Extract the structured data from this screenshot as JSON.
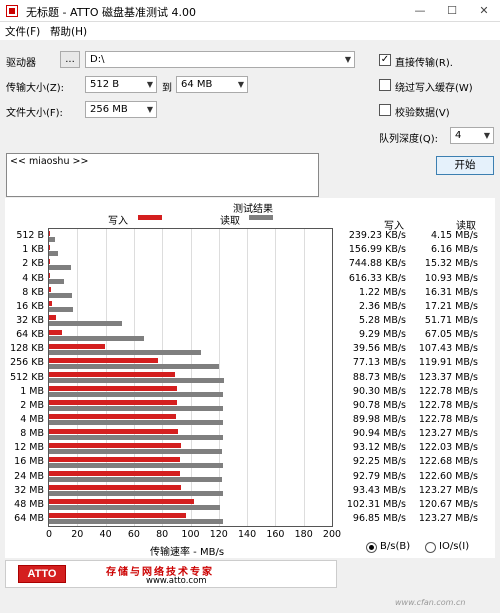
{
  "window": {
    "title": "无标题 - ATTO 磁盘基准测试 4.00",
    "minimize": "—",
    "maximize": "☐",
    "close": "✕"
  },
  "menu": {
    "file": "文件(F)",
    "help": "帮助(H)"
  },
  "controls": {
    "drive_label": "驱动器",
    "drive_browse": "...",
    "drive_value": "D:\\",
    "transfer_label": "传输大小(Z):",
    "transfer_from": "512 B",
    "to_label": "到",
    "transfer_to": "64 MB",
    "filesize_label": "文件大小(F):",
    "filesize_value": "256 MB",
    "direct_io_label": "直接传输(R).",
    "direct_io_checked": true,
    "bypass_cache_label": "绕过写入缓存(W)",
    "bypass_cache_checked": false,
    "verify_label": "校验数据(V)",
    "verify_checked": false,
    "queue_label": "队列深度(Q):",
    "queue_value": "4",
    "start_label": "开始",
    "description": "<< miaoshu >>"
  },
  "results": {
    "header": "测试结果",
    "legend_write": "写入",
    "legend_read": "读取",
    "col_write": "写入",
    "col_read": "读取",
    "xlabel": "传输速率 - MB/s",
    "unit_bs": "B/s(B)",
    "unit_ios": "IO/s(I)",
    "unit_selected": "bs"
  },
  "chart_data": {
    "type": "bar",
    "orientation": "horizontal",
    "xlim": [
      0,
      200
    ],
    "xticks": [
      0,
      20,
      40,
      60,
      80,
      100,
      120,
      140,
      160,
      180,
      200
    ],
    "categories": [
      "512 B",
      "1 KB",
      "2 KB",
      "4 KB",
      "8 KB",
      "16 KB",
      "32 KB",
      "64 KB",
      "128 KB",
      "256 KB",
      "512 KB",
      "1 MB",
      "2 MB",
      "4 MB",
      "8 MB",
      "12 MB",
      "16 MB",
      "24 MB",
      "32 MB",
      "48 MB",
      "64 MB"
    ],
    "series": [
      {
        "name": "写入",
        "color": "#d41f1f",
        "values": [
          0.23,
          0.15,
          0.73,
          0.6,
          1.19,
          2.3,
          5.16,
          9.08,
          39.56,
          77.13,
          88.73,
          90.3,
          90.78,
          89.98,
          90.94,
          93.12,
          92.25,
          92.79,
          93.43,
          102.31,
          96.85
        ]
      },
      {
        "name": "读取",
        "color": "#7f7f7f",
        "values": [
          4.15,
          6.16,
          15.32,
          10.93,
          16.31,
          17.21,
          51.71,
          67.05,
          107.43,
          119.91,
          123.37,
          122.78,
          122.78,
          122.78,
          123.27,
          122.03,
          122.68,
          122.6,
          123.27,
          120.67,
          123.27
        ]
      }
    ],
    "write_text": [
      "239.23 KB/s",
      "156.99 KB/s",
      "744.88 KB/s",
      "616.33 KB/s",
      "1.22 MB/s",
      "2.36 MB/s",
      "5.28 MB/s",
      "9.29 MB/s",
      "39.56 MB/s",
      "77.13 MB/s",
      "88.73 MB/s",
      "90.30 MB/s",
      "90.78 MB/s",
      "89.98 MB/s",
      "90.94 MB/s",
      "93.12 MB/s",
      "92.25 MB/s",
      "92.79 MB/s",
      "93.43 MB/s",
      "102.31 MB/s",
      "96.85 MB/s"
    ],
    "read_text": [
      "4.15 MB/s",
      "6.16 MB/s",
      "15.32 MB/s",
      "10.93 MB/s",
      "16.31 MB/s",
      "17.21 MB/s",
      "51.71 MB/s",
      "67.05 MB/s",
      "107.43 MB/s",
      "119.91 MB/s",
      "123.37 MB/s",
      "122.78 MB/s",
      "122.78 MB/s",
      "122.78 MB/s",
      "123.27 MB/s",
      "122.03 MB/s",
      "122.68 MB/s",
      "122.60 MB/s",
      "123.27 MB/s",
      "120.67 MB/s",
      "123.27 MB/s"
    ]
  },
  "banner": {
    "logo": "ATTO",
    "slogan": "存储与网络技术专家",
    "url": "www.atto.com"
  },
  "watermark": "www.cfan.com.cn"
}
